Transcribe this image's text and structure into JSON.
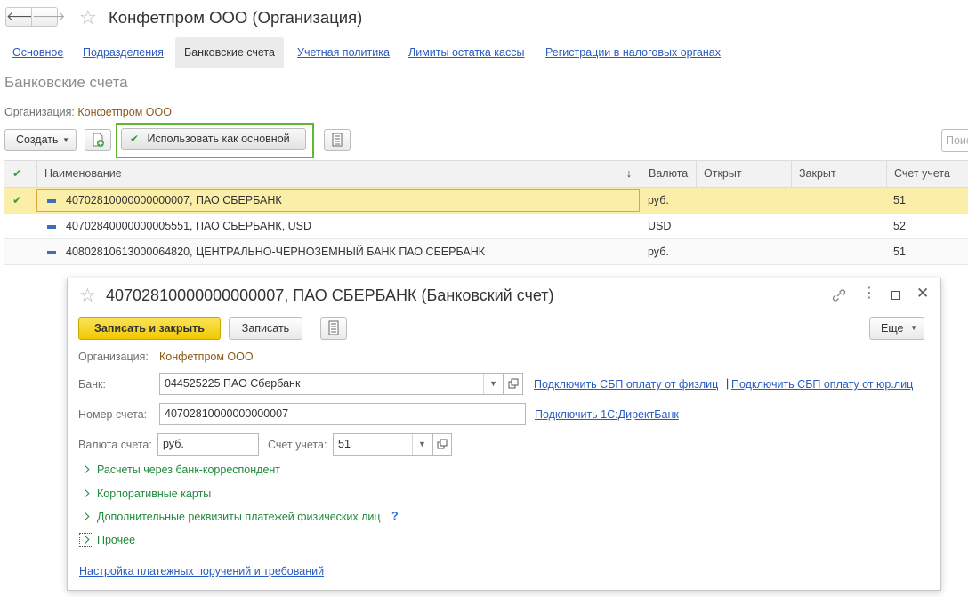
{
  "window": {
    "title": "Конфетпром ООО (Организация)"
  },
  "tabs": [
    {
      "label": "Основное"
    },
    {
      "label": "Подразделения"
    },
    {
      "label": "Банковские счета",
      "active": true
    },
    {
      "label": "Учетная политика"
    },
    {
      "label": "Лимиты остатка кассы"
    },
    {
      "label": "Регистрации в налоговых органах"
    }
  ],
  "list": {
    "section_title": "Банковские счета",
    "org_label": "Организация:",
    "org_value": "Конфетпром ООО",
    "create_label": "Создать",
    "use_main_label": "Использовать как основной",
    "search_placeholder": "Поиск (Ctrl+F)",
    "columns": {
      "name": "Наименование",
      "currency": "Валюта",
      "opened": "Открыт",
      "closed": "Закрыт",
      "account": "Счет учета"
    },
    "rows": [
      {
        "name": "40702810000000000007, ПАО СБЕРБАНК",
        "currency": "руб.",
        "account": "51"
      },
      {
        "name": "40702840000000005551, ПАО СБЕРБАНК, USD",
        "currency": "USD",
        "account": "52"
      },
      {
        "name": "40802810613000064820, ЦЕНТРАЛЬНО-ЧЕРНОЗЕМНЫЙ БАНК ПАО СБЕРБАНК",
        "currency": "руб.",
        "account": "51"
      }
    ]
  },
  "dialog": {
    "title": "40702810000000000007, ПАО СБЕРБАНК (Банковский счет)",
    "save_close_label": "Записать и закрыть",
    "save_label": "Записать",
    "more_label": "Еще",
    "org_label": "Организация:",
    "org_value": "Конфетпром ООО",
    "bank_label": "Банк:",
    "bank_value": "044525225 ПАО Сбербанк",
    "sbp_phys_link": "Подключить СБП оплату от физлиц",
    "separator": "|",
    "sbp_legal_link": "Подключить СБП оплату от юр.лиц",
    "account_label": "Номер счета:",
    "account_value": "40702810000000000007",
    "directbank_link": "Подключить 1С:ДиректБанк",
    "currency_label": "Валюта счета:",
    "currency_value": "руб.",
    "ledger_label": "Счет учета:",
    "ledger_value": "51",
    "groups": [
      {
        "label": "Расчеты через банк-корреспондент"
      },
      {
        "label": "Корпоративные карты"
      },
      {
        "label": "Дополнительные реквизиты платежей физических лиц"
      },
      {
        "label": "Прочее"
      }
    ],
    "hint_mark": "?",
    "settings_link": "Настройка платежных поручений и требований"
  },
  "colors": {
    "link": "#2a5bc1",
    "group_green": "#1f8a3b",
    "selected_row": "#fbeea8",
    "primary_button": "#f5d40a",
    "highlight_border": "#5fb832"
  }
}
